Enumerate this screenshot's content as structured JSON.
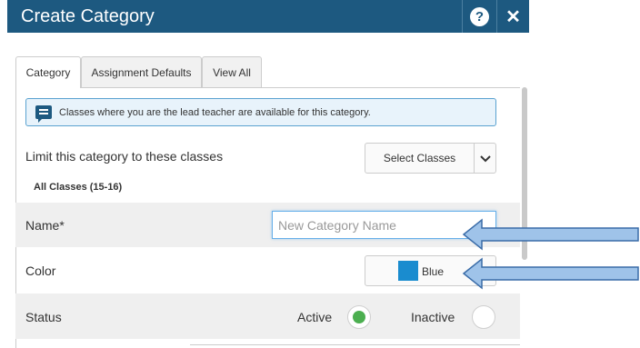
{
  "dialog": {
    "title": "Create Category",
    "help_icon_glyph": "?",
    "close_icon_glyph": "✕"
  },
  "tabs": [
    {
      "label": "Category",
      "active": true
    },
    {
      "label": "Assignment Defaults",
      "active": false
    },
    {
      "label": "View All",
      "active": false
    }
  ],
  "info": {
    "icon": "message-icon",
    "text": "Classes where you are the lead teacher are available for this category."
  },
  "limit": {
    "label": "Limit this category to these classes",
    "button_label": "Select Classes",
    "selected_text": "All Classes  (15-16)"
  },
  "name_field": {
    "label": "Name*",
    "value": "",
    "placeholder": "New Category Name"
  },
  "color_field": {
    "label": "Color",
    "value": "Blue",
    "swatch_color": "#1a8ccf"
  },
  "status_field": {
    "label": "Status",
    "options": [
      {
        "label": "Active",
        "selected": true
      },
      {
        "label": "Inactive",
        "selected": false
      }
    ],
    "active_color": "#4caf50"
  },
  "colors": {
    "header_bg": "#1d5980",
    "info_bg": "#e8f3fb",
    "info_border": "#5aa2d0",
    "arrow_fill": "#9fc3e9",
    "arrow_stroke": "#3a6ca8"
  }
}
